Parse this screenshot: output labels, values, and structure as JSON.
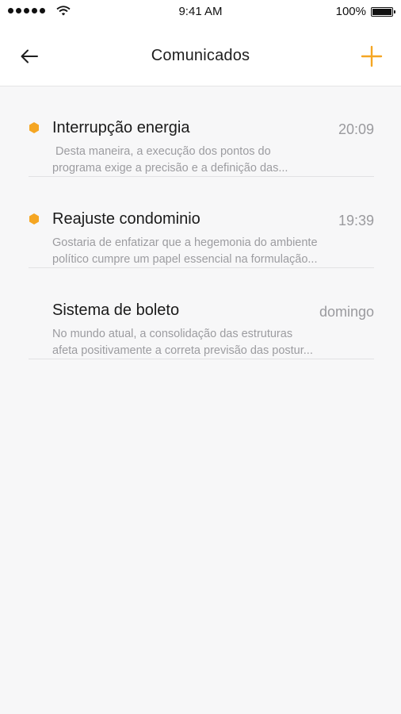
{
  "status_bar": {
    "time": "9:41 AM",
    "battery": "100%"
  },
  "header": {
    "title": "Comunicados",
    "back_icon": "arrow-left-icon",
    "add_icon": "plus-icon",
    "accent_color": "#f5a623"
  },
  "messages": [
    {
      "title": "Interrupção energia",
      "time": "20:09",
      "unread": true,
      "preview_line1": " Desta maneira, a execução dos pontos do",
      "preview_line2": "programa exige a precisão e a definição das..."
    },
    {
      "title": "Reajuste condominio",
      "time": "19:39",
      "unread": true,
      "preview_line1": "Gostaria de enfatizar que a hegemonia do ambiente",
      "preview_line2": "político cumpre um papel essencial na formulação..."
    },
    {
      "title": "Sistema de boleto",
      "time": "domingo",
      "unread": false,
      "preview_line1": "No mundo atual, a consolidação das estruturas",
      "preview_line2": "afeta positivamente a correta previsão das postur..."
    }
  ]
}
